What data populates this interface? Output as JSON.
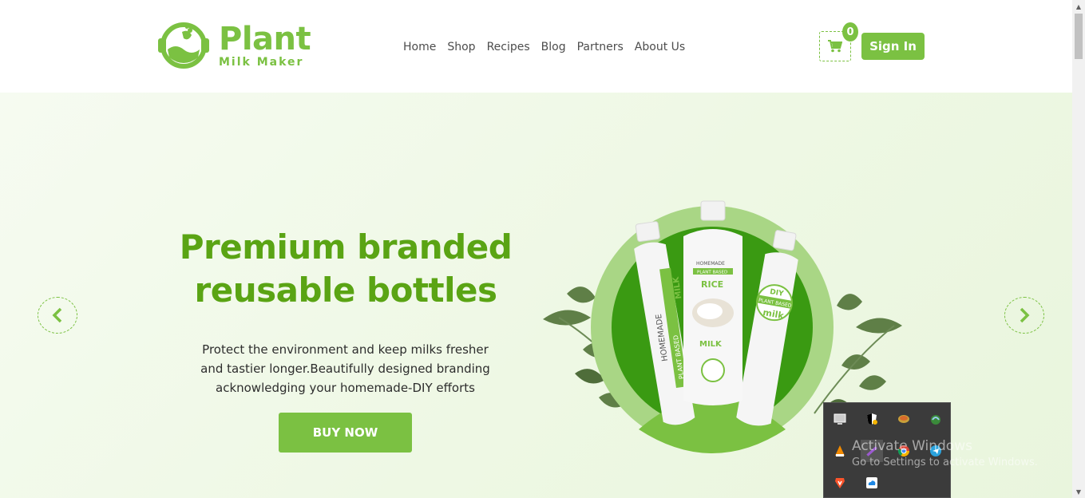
{
  "logo": {
    "title": "Plant",
    "subtitle": "Milk Maker"
  },
  "nav": {
    "items": [
      "Home",
      "Shop",
      "Recipes",
      "Blog",
      "Partners",
      "About Us"
    ]
  },
  "cart": {
    "count": "0"
  },
  "header": {
    "signin_label": "Sign In"
  },
  "hero": {
    "title_line1": "Premium branded",
    "title_line2": "reusable bottles",
    "text_line1": "Protect the environment and keep milks fresher",
    "text_line2": "and tastier longer.Beautifully designed branding",
    "text_line3": "acknowledging your homemade-DIY efforts",
    "buy_label": "BUY NOW"
  },
  "bottles": {
    "left": {
      "text1": "HOMEMADE",
      "text2": "PLANT BASED",
      "text3": "MILK"
    },
    "center": {
      "text1": "HOMEMADE",
      "text2": "PLANT BASED",
      "text3": "RICE",
      "text4": "MILK"
    },
    "right": {
      "text1": "DIY",
      "text2": "PLANT BASED",
      "text3": "milk"
    }
  },
  "system": {
    "activate_title": "Activate Windows",
    "activate_sub": "Go to Settings to activate Windows."
  },
  "colors": {
    "brand_green": "#7bc142",
    "title_green": "#5aa414",
    "dark_green": "#3a9a12"
  }
}
